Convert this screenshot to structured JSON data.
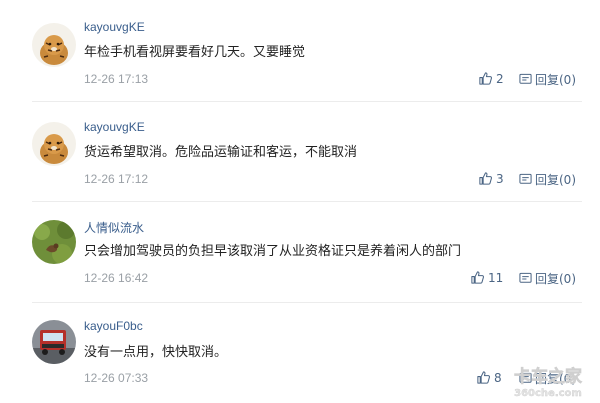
{
  "comments": [
    {
      "username": "kayouvgKE",
      "content": "年检手机看视屏要看好几天。又要睡觉",
      "time": "12-26 17:13",
      "likes": "2",
      "reply_label": "回复(0)"
    },
    {
      "username": "kayouvgKE",
      "content": "货运希望取消。危险品运输证和客运，不能取消",
      "time": "12-26 17:12",
      "likes": "3",
      "reply_label": "回复(0)"
    },
    {
      "username": "人情似流水",
      "content": "只会增加驾驶员的负担早该取消了从业资格证只是养着闲人的部门",
      "time": "12-26 16:42",
      "likes": "11",
      "reply_label": "回复(0)"
    },
    {
      "username": "kayouF0bc",
      "content": "没有一点用，快快取消。",
      "time": "12-26 07:33",
      "likes": "8",
      "reply_label": "回复(0)"
    }
  ],
  "watermark": {
    "line1": "卡车之家",
    "line2": "360che.com"
  },
  "icons": [
    "thumbs-up-icon",
    "reply-icon"
  ],
  "colors": {
    "link": "#3a5e8c",
    "meta": "#9aa0a6",
    "action": "#4b6584",
    "divider": "#ececec"
  }
}
